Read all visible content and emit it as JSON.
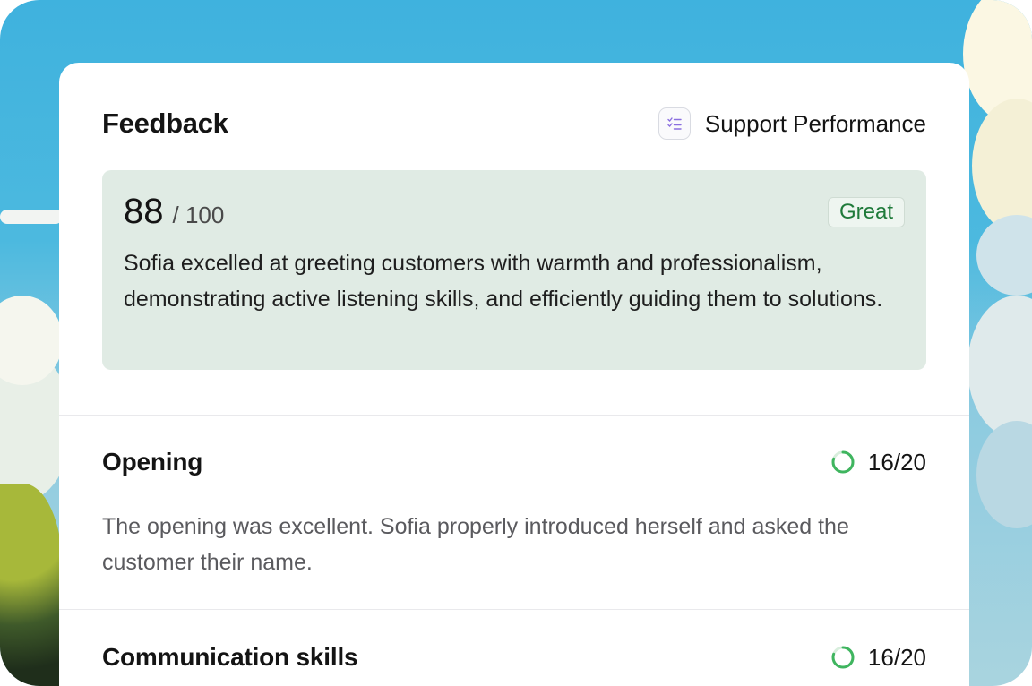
{
  "header": {
    "title": "Feedback",
    "category_icon": "checklist-icon",
    "category_label": "Support Performance"
  },
  "score": {
    "value": "88",
    "max": "/ 100",
    "badge": "Great",
    "summary": "Sofia excelled at greeting customers with warmth and professionalism, demonstrating active listening skills, and efficiently guiding them to solutions."
  },
  "sections": [
    {
      "title": "Opening",
      "rating": "16/20",
      "progress": 0.8,
      "text": "The opening was excellent. Sofia properly introduced herself and asked the customer their name."
    },
    {
      "title": "Communication skills",
      "rating": "16/20",
      "progress": 0.8
    }
  ],
  "colors": {
    "accent_green": "#3fb55f",
    "badge_green": "#1f7a3a",
    "score_bg": "#e0ebe4"
  }
}
